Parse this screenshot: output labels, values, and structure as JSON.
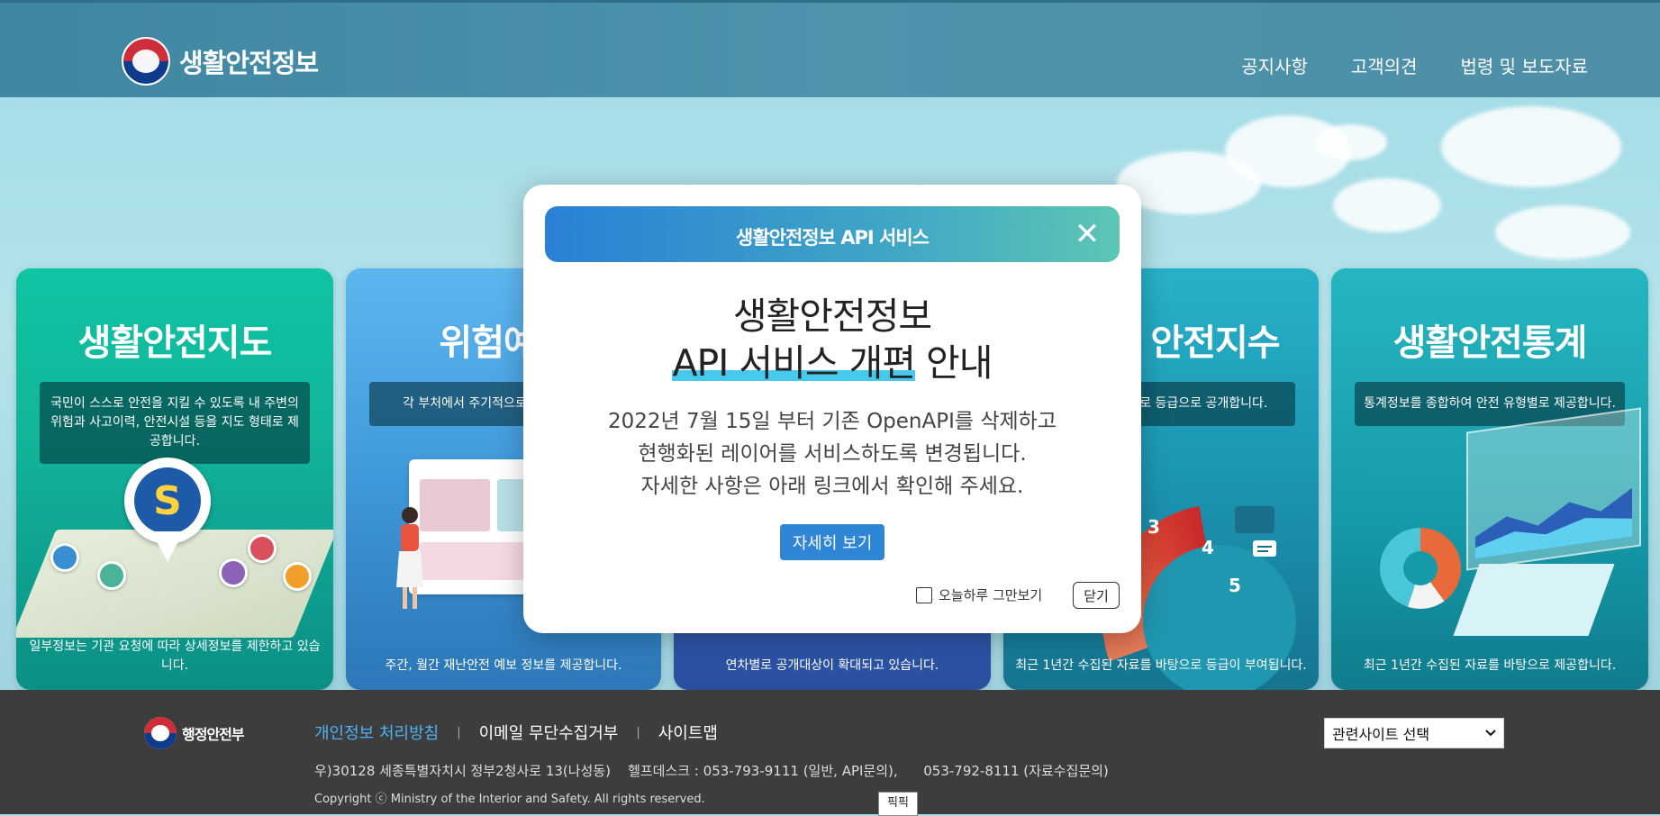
{
  "header": {
    "logo_text": "생활안전정보",
    "nav": [
      "공지사항",
      "고객의견",
      "법령 및 보도자료"
    ]
  },
  "cards": {
    "map": {
      "title": "생활안전지도",
      "desc": "국민이 스스로 안전을 지킬 수 있도록 내 주변의 위험과 사고이력, 안전시설 등을 지도 형태로 제공합니다.",
      "foot": "일부정보는 기관 요청에 따라 상세정보를 제한하고 있습니다."
    },
    "risk": {
      "title": "위험예방",
      "desc": "각 부처에서 주기적으로 발 제공합니다",
      "foot": "주간, 월간 재난안전 예보 정보를 제공합니다."
    },
    "mid": {
      "foot": "연차별로 공개대상이 확대되고 있습니다."
    },
    "index": {
      "title": "안전지수",
      "desc": "수준을 객관적으로 등급으로 공개합니다.",
      "foot": "최근 1년간 수집된 자료를 바탕으로 등급이 부여됩니다.",
      "gauge_numbers": [
        "3",
        "4",
        "5"
      ]
    },
    "stats": {
      "title": "생활안전통계",
      "desc": "통계정보를 종합하여 안전 유형별로 제공합니다.",
      "foot": "최근 1년간 수집된 자료를 바탕으로 제공합니다."
    }
  },
  "modal": {
    "header_title": "생활안전정보 API 서비스",
    "close_symbol": "✕",
    "title_line1": "생활안전정보",
    "title_highlight": "API 서비스 개편",
    "title_rest": " 안내",
    "body_lines": [
      "2022년 7월 15일 부터 기존 OpenAPI를 삭제하고",
      "현행화된 레이어를 서비스하도록 변경됩니다.",
      "자세한 사항은 아래 링크에서 확인해 주세요."
    ],
    "detail_button": "자세히 보기",
    "dont_show_today": "오늘하루 그만보기",
    "close_button": "닫기"
  },
  "footer": {
    "logo_text": "행정안전부",
    "links": [
      "개인정보 처리방침",
      "이메일 무단수집거부",
      "사이트맵"
    ],
    "address": "우)30128 세종특별자치시 정부2청사로 13(나성동)    헬프데스크 : 053-793-9111 (일반, API문의),      053-792-8111 (자료수집문의)",
    "copyright": "Copyright ⓒ Ministry of the Interior and Safety. All rights reserved.",
    "related_select": "관련사이트 선택",
    "tooltip": "픽픽"
  }
}
